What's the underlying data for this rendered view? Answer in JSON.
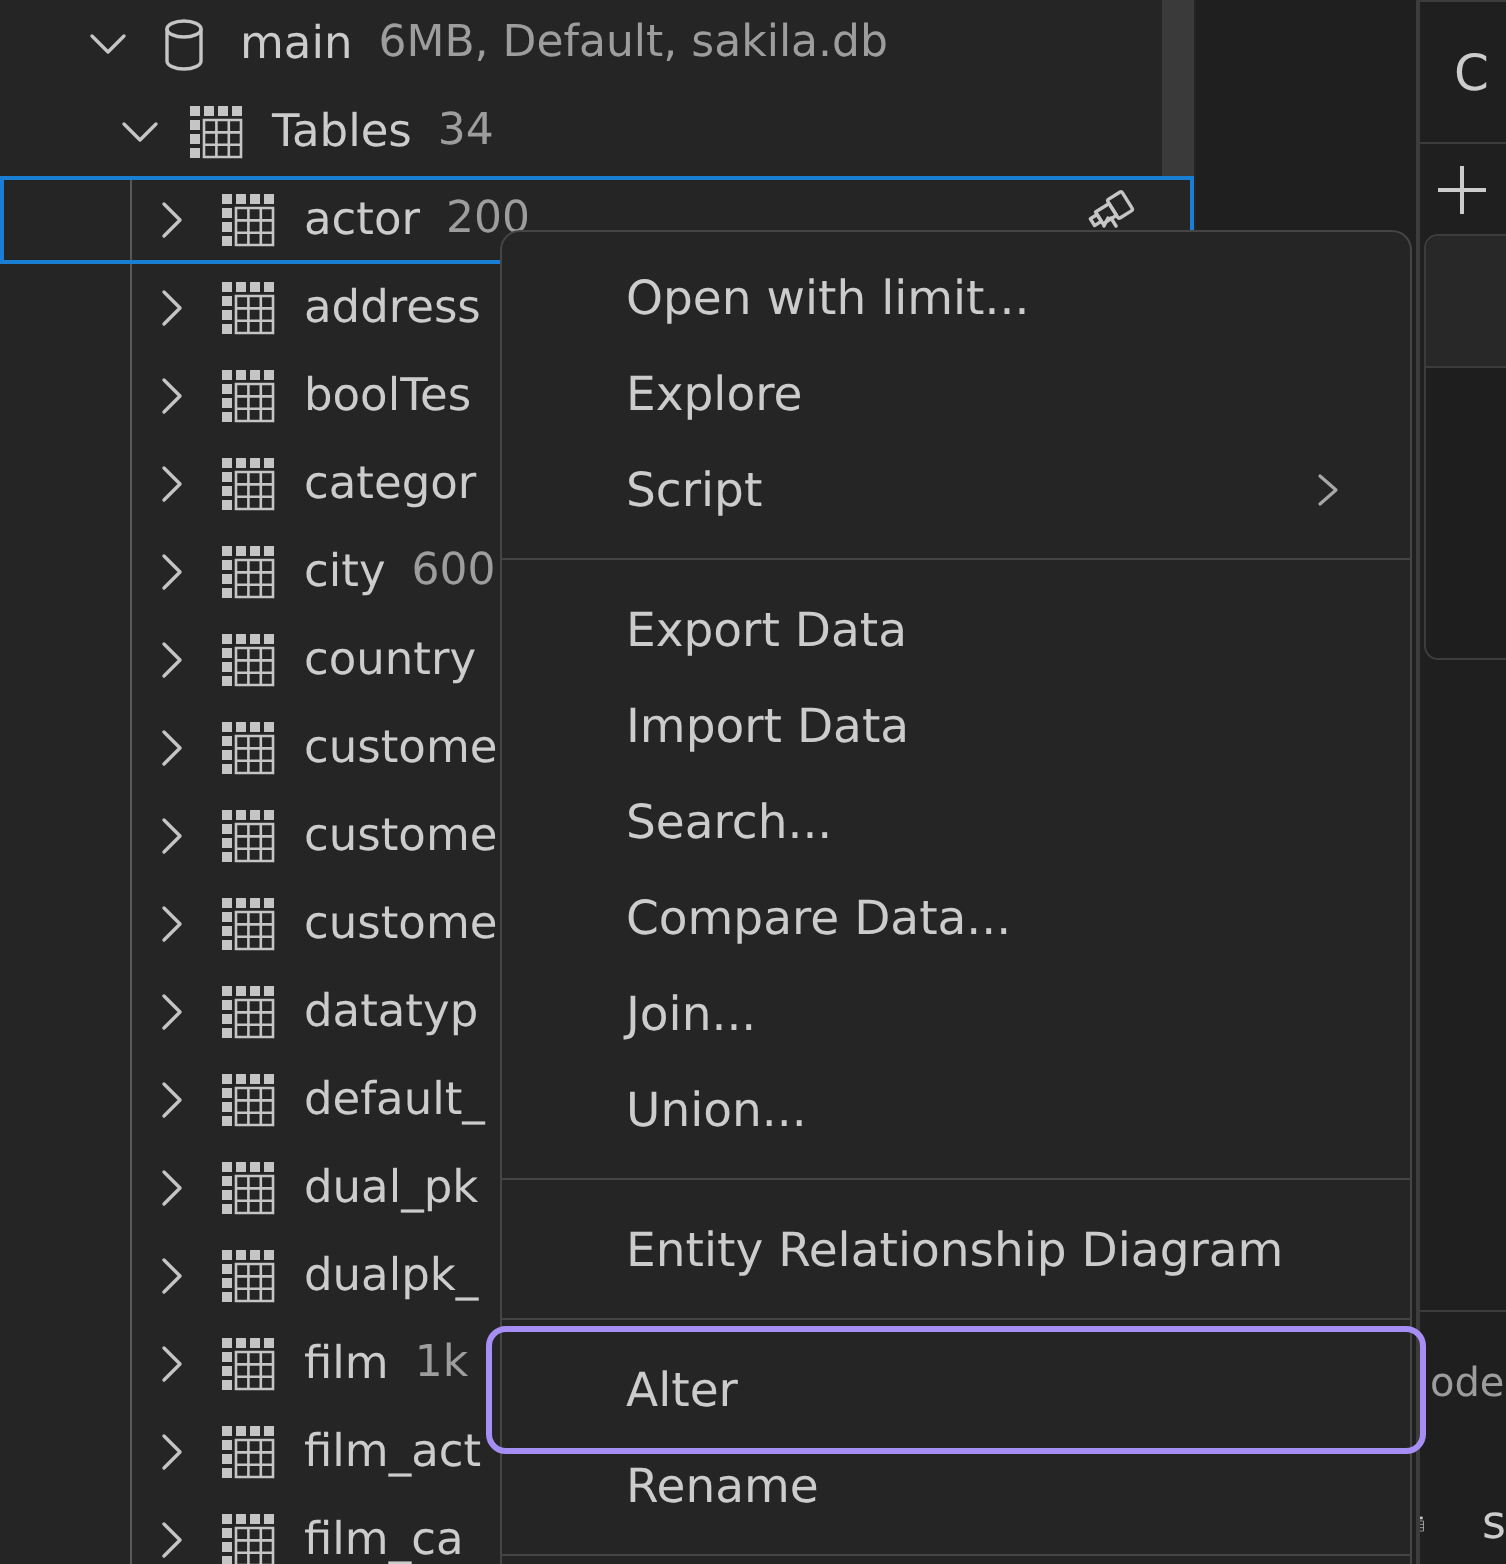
{
  "tree": [
    {
      "kind": "database",
      "label": "main",
      "meta": "6MB, Default, sakila.db",
      "expanded": true,
      "selected": false,
      "children": [
        {
          "kind": "folder",
          "label": "Tables",
          "meta": "34",
          "expanded": true,
          "selected": false,
          "children": [
            {
              "kind": "table",
              "label": "actor",
              "meta": "200",
              "expanded": false,
              "selected": true
            },
            {
              "kind": "table",
              "label": "address",
              "expanded": false,
              "selected": false
            },
            {
              "kind": "table",
              "label": "boolTes",
              "expanded": false,
              "selected": false
            },
            {
              "kind": "table",
              "label": "categor",
              "expanded": false,
              "selected": false
            },
            {
              "kind": "table",
              "label": "city",
              "meta": "600",
              "expanded": false,
              "selected": false
            },
            {
              "kind": "table",
              "label": "country",
              "expanded": false,
              "selected": false
            },
            {
              "kind": "table",
              "label": "custome",
              "expanded": false,
              "selected": false
            },
            {
              "kind": "table",
              "label": "custome",
              "expanded": false,
              "selected": false
            },
            {
              "kind": "table",
              "label": "custome",
              "expanded": false,
              "selected": false
            },
            {
              "kind": "table",
              "label": "datatyp",
              "expanded": false,
              "selected": false
            },
            {
              "kind": "table",
              "label": "default_",
              "expanded": false,
              "selected": false
            },
            {
              "kind": "table",
              "label": "dual_pk",
              "expanded": false,
              "selected": false
            },
            {
              "kind": "table",
              "label": "dualpk_",
              "expanded": false,
              "selected": false
            },
            {
              "kind": "table",
              "label": "film",
              "meta": "1k",
              "expanded": false,
              "selected": false
            },
            {
              "kind": "table",
              "label": "film_act",
              "expanded": false,
              "selected": false
            },
            {
              "kind": "table",
              "label": "film_ca",
              "expanded": false,
              "selected": false
            }
          ]
        }
      ]
    }
  ],
  "context_menu": {
    "groups": [
      {
        "items": [
          {
            "label": "Open with limit...",
            "submenu": false,
            "focused": false
          },
          {
            "label": "Explore",
            "submenu": false,
            "focused": false
          },
          {
            "label": "Script",
            "submenu": true,
            "focused": false
          }
        ]
      },
      {
        "items": [
          {
            "label": "Export Data",
            "submenu": false,
            "focused": false
          },
          {
            "label": "Import Data",
            "submenu": false,
            "focused": false
          },
          {
            "label": "Search...",
            "submenu": false,
            "focused": false
          },
          {
            "label": "Compare Data...",
            "submenu": false,
            "focused": false
          },
          {
            "label": "Join...",
            "submenu": false,
            "focused": false
          },
          {
            "label": "Union...",
            "submenu": false,
            "focused": false
          }
        ]
      },
      {
        "items": [
          {
            "label": "Entity Relationship Diagram",
            "submenu": false,
            "focused": false
          }
        ]
      },
      {
        "items": [
          {
            "label": "Alter",
            "submenu": false,
            "focused": true
          },
          {
            "label": "Rename",
            "submenu": false,
            "focused": false
          }
        ]
      }
    ]
  },
  "side_panel": {
    "title": "C",
    "section_label": "ode",
    "list_item": "s"
  }
}
